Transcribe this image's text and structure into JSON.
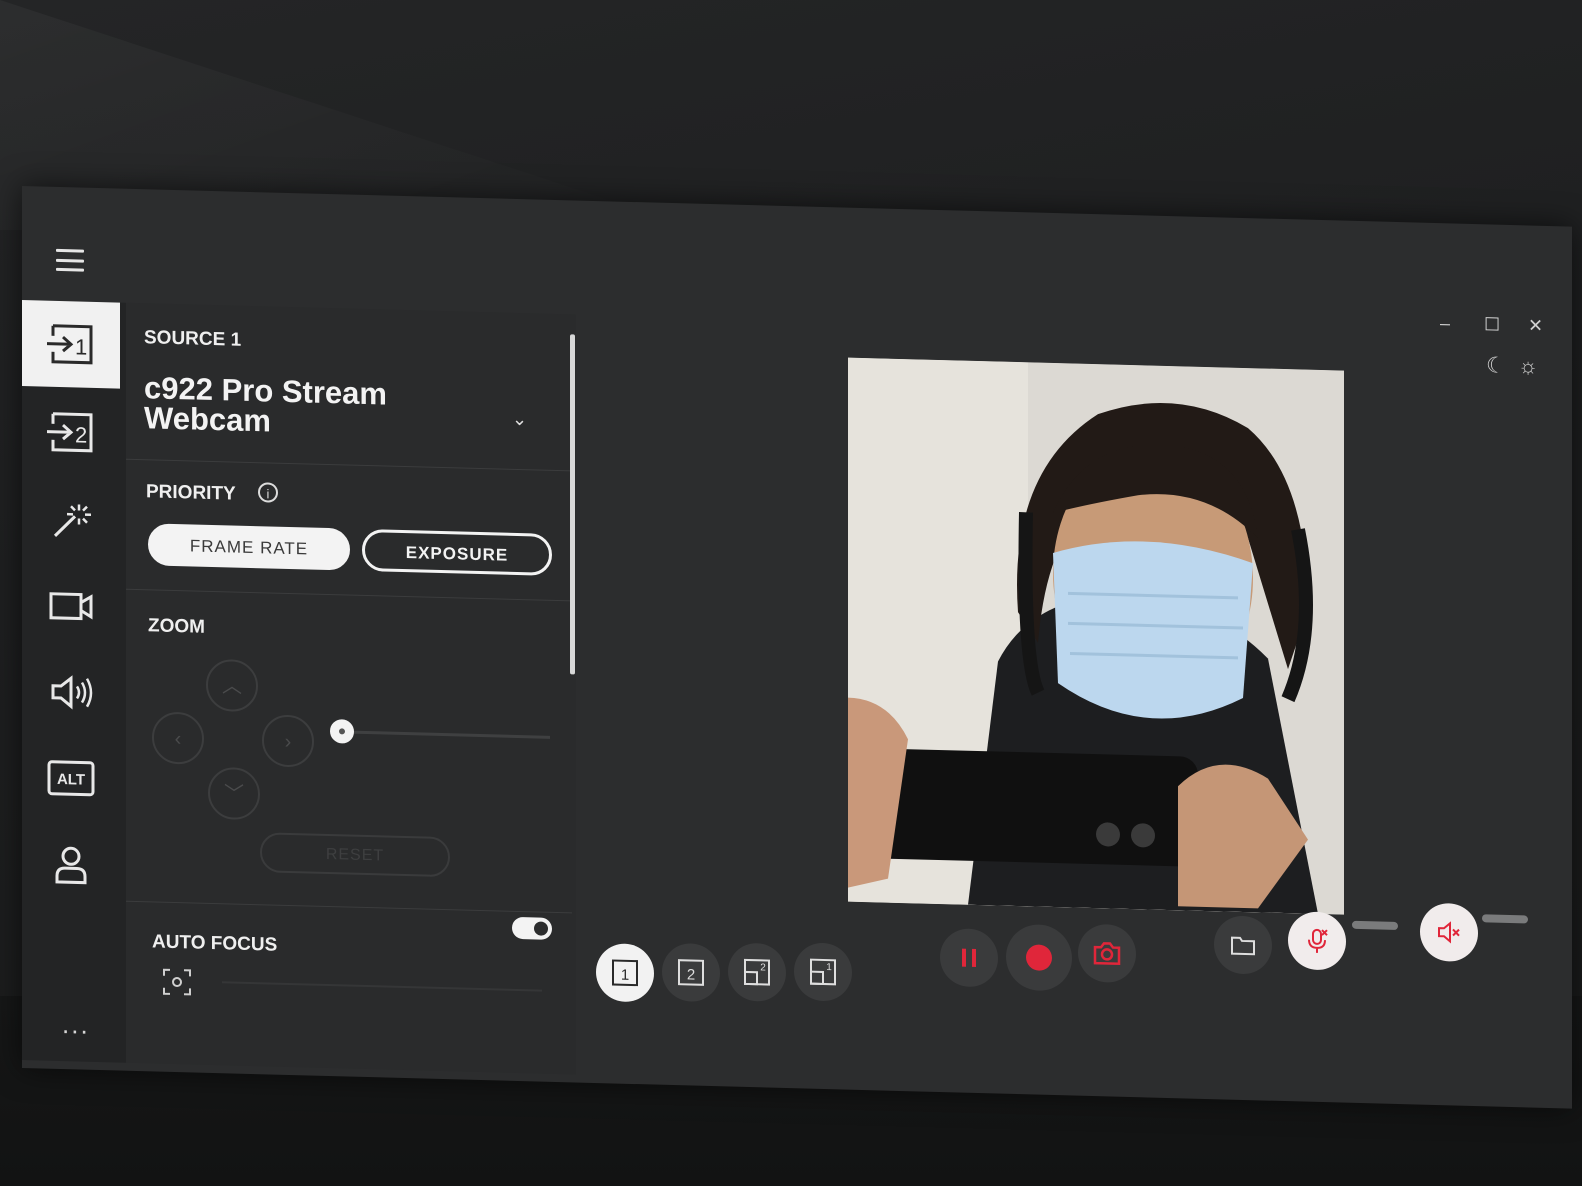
{
  "window": {
    "minimize": "–",
    "maximize": "☐",
    "close": "✕"
  },
  "theme": {
    "moon_glyph": "☾",
    "sun_glyph": "☼"
  },
  "sidebar": {
    "items": [
      {
        "name": "source-1",
        "label": "→1",
        "active": true
      },
      {
        "name": "source-2",
        "label": "→2",
        "active": false
      },
      {
        "name": "effects",
        "label": "",
        "active": false
      },
      {
        "name": "camera",
        "label": "",
        "active": false
      },
      {
        "name": "audio",
        "label": "",
        "active": false
      },
      {
        "name": "alt",
        "label": "ALT",
        "active": false
      },
      {
        "name": "account",
        "label": "",
        "active": false
      }
    ],
    "more_label": "..."
  },
  "panel": {
    "source_label": "SOURCE 1",
    "source_name": "c922 Pro Stream Webcam",
    "priority_label": "PRIORITY",
    "info_glyph": "i",
    "frame_rate_label": "FRAME RATE",
    "exposure_label": "EXPOSURE",
    "priority_selected": "FRAME RATE",
    "zoom_label": "ZOOM",
    "zoom_level": 0,
    "reset_label": "RESET",
    "auto_focus_label": "AUTO FOCUS",
    "auto_focus_on": true
  },
  "bottom_bar": {
    "scene_buttons": [
      "1",
      "2",
      "2",
      "1"
    ],
    "selected_scene": "1"
  },
  "icons": [
    "menu-icon",
    "source-1-icon",
    "source-2-icon",
    "magic-wand-icon",
    "camera-icon",
    "speaker-icon",
    "alt-icon",
    "user-icon",
    "pause-icon",
    "record-icon",
    "snapshot-icon",
    "folder-icon",
    "mic-muted-icon",
    "speaker-muted-icon"
  ],
  "colors": {
    "accent_red": "#e0263a",
    "panel_bg": "#2a2b2c",
    "active_bg": "#f1f1f1"
  }
}
